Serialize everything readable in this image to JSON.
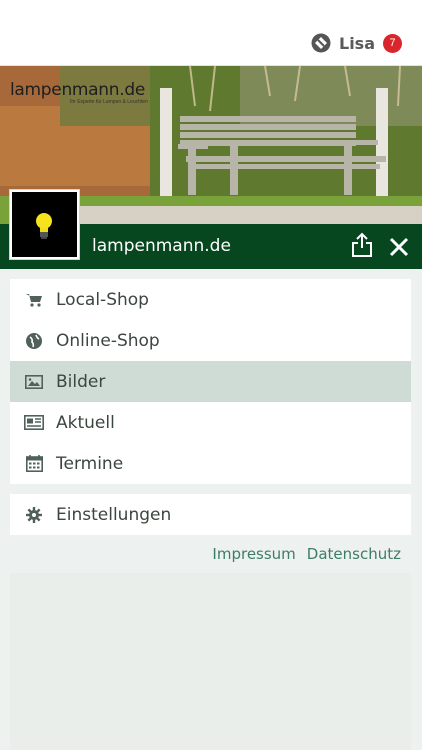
{
  "header": {
    "user_name": "Lisa",
    "notification_count": "7",
    "icons": {
      "user": "user-switch-icon"
    }
  },
  "hero": {
    "logo_text": "lampenmann.de",
    "logo_tagline": "Ihr Experte für Lampen & Leuchten"
  },
  "titlebar": {
    "site_name": "lampenmann.de",
    "icons": {
      "share": "share-icon",
      "close": "close-icon"
    },
    "color": "#07471f"
  },
  "menu": {
    "items": [
      {
        "label": "Local-Shop",
        "icon": "cart-icon"
      },
      {
        "label": "Online-Shop",
        "icon": "globe-icon"
      },
      {
        "label": "Bilder",
        "icon": "image-icon",
        "active": true
      },
      {
        "label": "Aktuell",
        "icon": "newspaper-icon"
      },
      {
        "label": "Termine",
        "icon": "calendar-icon"
      }
    ]
  },
  "settings": {
    "label": "Einstellungen",
    "icon": "gear-icon"
  },
  "links": {
    "impressum": "Impressum",
    "datenschutz": "Datenschutz"
  },
  "colors": {
    "accent": "#07471f",
    "link": "#3e7c6a",
    "active_bg": "#cfdcd6",
    "badge": "#d9262c"
  }
}
